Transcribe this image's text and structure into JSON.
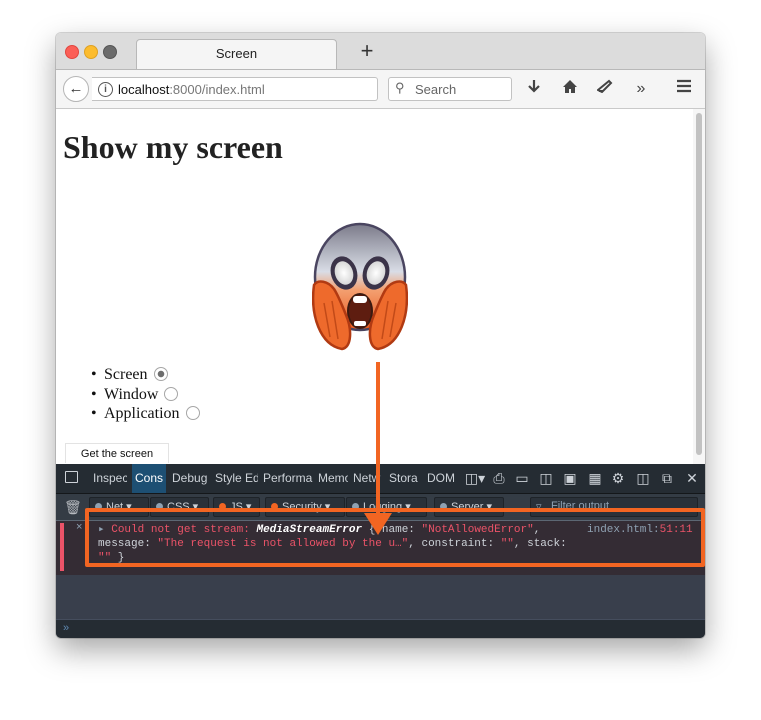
{
  "browser": {
    "tab_title": "Screen",
    "new_tab_glyph": "+",
    "url_host": "localhost",
    "url_rest": ":8000/index.html",
    "search_placeholder": "Search",
    "toolbar_icons": [
      "download-icon",
      "home-icon",
      "pocket-icon",
      "overflow-icon",
      "menu-icon"
    ]
  },
  "page": {
    "heading": "Show my screen",
    "sources": [
      {
        "label": "Screen",
        "checked": true
      },
      {
        "label": "Window",
        "checked": false
      },
      {
        "label": "Application",
        "checked": false
      }
    ],
    "button_label": "Get the screen",
    "emoji": "face-screaming-in-fear"
  },
  "devtools": {
    "tabs": [
      "Inspec",
      "Cons",
      "Debug",
      "Style Ed",
      "Performa",
      "Memo",
      "Netw",
      "Stora",
      "DOM"
    ],
    "active_tab": "Cons",
    "filters": [
      {
        "label": "Net",
        "color": "#8fa1b2"
      },
      {
        "label": "CSS",
        "color": "#8fa1b2"
      },
      {
        "label": "JS",
        "color": "#f26522"
      },
      {
        "label": "Security",
        "color": "#f26522"
      },
      {
        "label": "Logging",
        "color": "#8fa1b2"
      },
      {
        "label": "Server",
        "color": "#8fa1b2"
      }
    ],
    "filter_placeholder": "Filter output",
    "message": {
      "prefix": "Could not get stream: ",
      "object_name": "MediaStreamError",
      "brace_open": " { name: ",
      "name_value": "\"NotAllowedError\"",
      "comma1": ",",
      "line2_key": "message: ",
      "message_value": "\"The request is not allowed by the u…\"",
      "constraint_key": ", constraint: ",
      "constraint_value": "\"\"",
      "stack_key": ", stack:",
      "stack_value": "\"\"",
      "brace_close": " }",
      "location_file": "index.html:",
      "location_line": "51:11"
    }
  },
  "colors": {
    "highlight": "#f26522",
    "error_text": "#eb5368",
    "devtools_bg": "#393f4c"
  }
}
